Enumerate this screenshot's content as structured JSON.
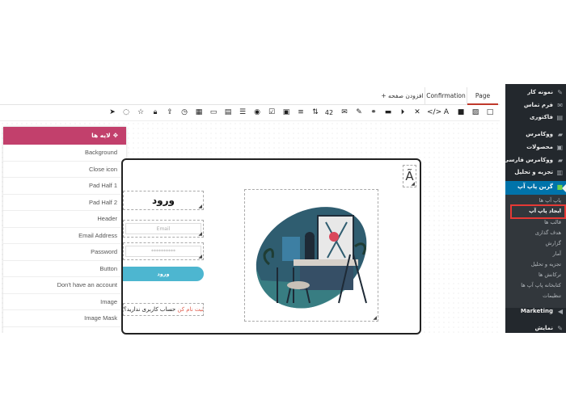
{
  "tabs": {
    "page": "Page",
    "confirmation": "Confirmation",
    "add_page": "+ افزودن صفحه"
  },
  "toolbar": {
    "font_size": "42",
    "icons": [
      "send-icon",
      "eye-off-icon",
      "star-icon",
      "lock-icon",
      "upload-icon",
      "clock-icon",
      "calendar-icon",
      "input-icon",
      "image-gallery-icon",
      "list-icon",
      "radio-icon",
      "checkbox-icon",
      "play-icon",
      "align-icon",
      "sort-icon",
      "font-size",
      "mail-icon",
      "brush-icon",
      "link-icon",
      "divider-icon",
      "video-icon",
      "close-icon",
      "code-icon",
      "text-icon",
      "camera-icon",
      "image-icon",
      "square-icon"
    ]
  },
  "layers": {
    "title": "لایه ها",
    "items": [
      "Background",
      "Close icon",
      "Pad Half 1",
      "Pad Half 2",
      "Header",
      "Email Address",
      "Password",
      "Button",
      "Don't have an account",
      "Image",
      "Image Mask"
    ]
  },
  "canvas": {
    "title": "ورود",
    "email_placeholder": "Email",
    "password_placeholder": "**********",
    "button": "ورود",
    "signup_text": "حساب کاربری ندارید؟",
    "signup_link": "ثبت نام کن",
    "close_glyph": "Ã"
  },
  "admin_menu": {
    "items_top": [
      "نمونه کار",
      "فرم تماس",
      "فاکتوری"
    ],
    "woo": [
      "ووکامرس",
      "محصولات",
      "ووکامرس فارسی",
      "تجزیه و تحلیل"
    ],
    "active": "گرین پاپ آپ",
    "sub": [
      "پاپ آپ ها",
      "ایجاد پاپ آپ",
      "قالب ها",
      "هدف گذاری",
      "گزارش",
      "آمار",
      "تجزیه و تحلیل",
      "ترکانش ها",
      "کتابخانه پاپ آپ ها",
      "تنظیمات"
    ],
    "bottom": [
      "Marketing",
      "نمایش"
    ]
  },
  "colors": {
    "layers_header": "#c2406c",
    "button": "#4db6d0",
    "admin_bg": "#23282d",
    "admin_active": "#0073aa",
    "highlight": "#e53935"
  }
}
